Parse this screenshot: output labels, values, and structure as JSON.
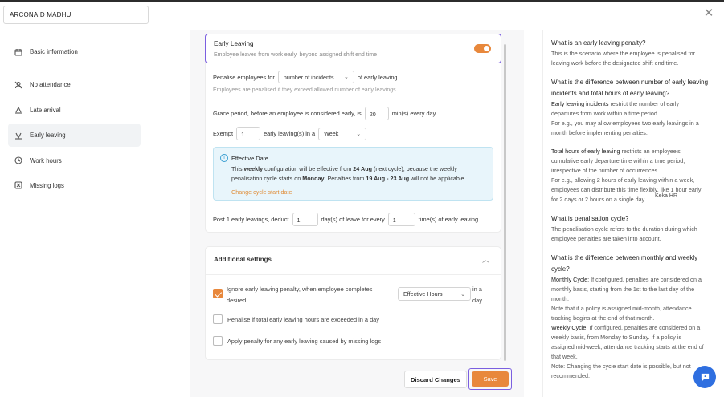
{
  "header": {
    "title": "ARCONAID MADHU"
  },
  "sidebar": {
    "items": [
      {
        "label": "Basic information",
        "icon": "calendar-icon"
      },
      {
        "label": "No attendance",
        "icon": "no-attendance-icon"
      },
      {
        "label": "Late arrival",
        "icon": "late-arrival-icon"
      },
      {
        "label": "Early leaving",
        "icon": "early-leaving-icon",
        "active": true
      },
      {
        "label": "Work hours",
        "icon": "work-hours-icon"
      },
      {
        "label": "Missing logs",
        "icon": "missing-logs-icon"
      }
    ]
  },
  "early": {
    "title": "Early Leaving",
    "subtitle": "Employee leaves from work early, beyond assigned shift end time",
    "toggle_on": true,
    "penalise_prefix": "Penalise employees for",
    "penalise_select": "number of incidents",
    "penalise_suffix": "of early leaving",
    "penalise_note": "Employees are penalised if they exceed allowed number of early leavings",
    "grace_prefix": "Grace period, before an employee is considered early, is",
    "grace_value": "20",
    "grace_suffix": "min(s) every day",
    "exempt_prefix": "Exempt",
    "exempt_value": "1",
    "exempt_mid": "early leaving(s) in a",
    "exempt_period": "Week",
    "info": {
      "title": "Effective Date",
      "line1_pre": "This ",
      "line1_b1": "weekly",
      "line1_mid": " configuration will be effective from ",
      "line1_b2": "24 Aug",
      "line1_post": " (next cycle), because the weekly",
      "line2_pre": "penalisation cycle starts on ",
      "line2_b1": "Monday",
      "line2_mid": ". Penalties from ",
      "line2_b2": "19 Aug - 23 Aug",
      "line2_post": " will not be applicable.",
      "link": "Change cycle start date"
    },
    "deduct_prefix": "Post 1 early leavings, deduct",
    "deduct_value": "1",
    "deduct_mid": "day(s) of leave for every",
    "every_value": "1",
    "deduct_suffix": "time(s) of early leaving"
  },
  "additional": {
    "title": "Additional settings",
    "opt1_line1": "Ignore early leaving penalty, when employee completes",
    "opt1_line2": "desired",
    "opt1_select": "Effective Hours",
    "opt1_after1": "in a",
    "opt1_after2": "day",
    "opt1_checked": true,
    "opt2": "Penalise if total early leaving hours are exceeded in a day",
    "opt2_checked": false,
    "opt3": "Apply penalty for any early leaving caused by missing logs",
    "opt3_checked": false
  },
  "footer": {
    "discard": "Discard Changes",
    "save": "Save"
  },
  "help": {
    "q1": "What is an early leaving penalty?",
    "a1": [
      "This is the scenario where the employee is penalised for",
      "leaving work before the designated shift end time."
    ],
    "q2": [
      "What is the difference between number of early leaving",
      "incidents and total hours of early leaving?"
    ],
    "a2_b": "Early leaving incidents",
    "a2": [
      " restrict the number of early",
      "departures from work within a time period.",
      "For e.g., you may allow employees two early leavings in a",
      "month before implementing penalties."
    ],
    "a3_b": "Total hours of early leaving",
    "a3": [
      " restricts an employee's",
      "cumulative early departure time within a time period,",
      "irrespective of the number of occurrences.",
      "For e.g., allowing 2 hours of early leaving within a week,",
      "employees can distribute this time flexibly, like 1 hour early",
      "for 2 days or 2 hours on a single day."
    ],
    "q3": "What is penalisation cycle?",
    "a4": [
      "The penalisation cycle refers to the duration during which",
      "employee penalties are taken into account."
    ],
    "q4": [
      "What is the difference between monthly and weekly",
      "cycle?"
    ],
    "a5_b": "Monthly Cycle:",
    "a5": [
      " If configured, penalties are considered on a",
      "monthly basis, starting from the 1st to the last day of the",
      "month.",
      "Note that if a policy is assigned mid-month, attendance",
      "tracking begins at the end of that month."
    ],
    "a6_b": "Weekly Cycle:",
    "a6": [
      " If configured, penalties are considered on a",
      "weekly basis, from Monday to Sunday. If a policy is",
      "assigned mid-week, attendance tracking starts at the end of",
      "that week.",
      "Note: Changing the cycle start date is possible, but not",
      "recommended."
    ],
    "watermark": "Keka HR"
  },
  "colors": {
    "accent": "#e8883c",
    "focus": "#7b5fe0",
    "info_bg": "#e8f5fb",
    "chat": "#2f6fe0"
  }
}
